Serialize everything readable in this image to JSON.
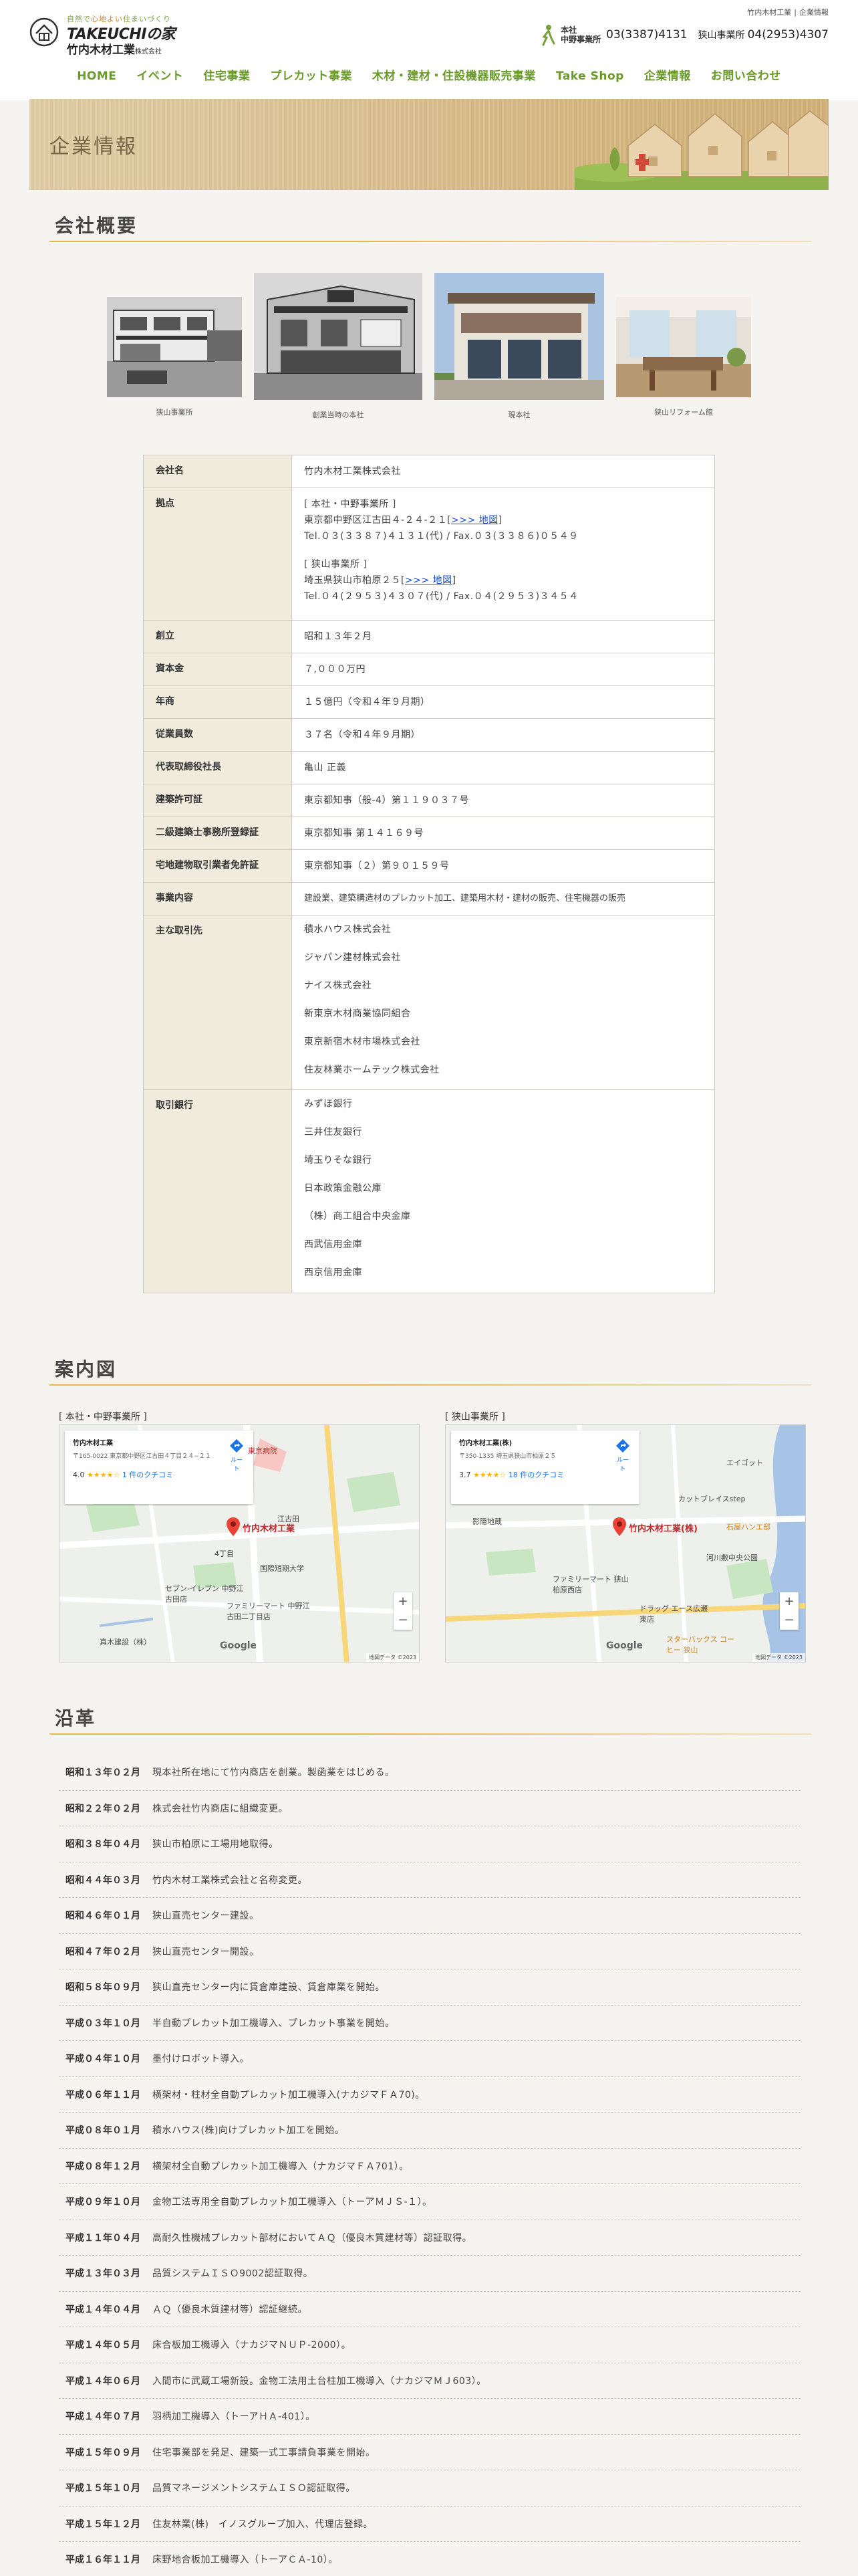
{
  "header": {
    "tagline_pre": "自然で",
    "tagline_em": "心地よい",
    "tagline_post": "住まいづくり",
    "brand": "TAKEUCHIの家",
    "company": "竹内木材工業",
    "company_suffix": "株式会社",
    "util_links": [
      "竹内木材工業",
      "企業情報"
    ],
    "contact": {
      "label_line1": "本社",
      "label_line2": "中野事業所",
      "tel_main": "03(3387)4131",
      "sub_label": "狭山事業所",
      "tel_sub": "04(2953)4307"
    },
    "nav": [
      "HOME",
      "イベント",
      "住宅事業",
      "プレカット事業",
      "木材・建材・住設機器販売事業",
      "Take Shop",
      "企業情報",
      "お問い合わせ"
    ]
  },
  "hero": {
    "title": "企業情報"
  },
  "sections": {
    "overview": "会社概要",
    "map": "案内図",
    "history": "沿革"
  },
  "photos": [
    {
      "caption": "狭山事業所"
    },
    {
      "caption": "創業当時の本社"
    },
    {
      "caption": "現本社"
    },
    {
      "caption": "狭山リフォーム館"
    }
  ],
  "overview": {
    "name": {
      "label": "会社名",
      "value": "竹内木材工業株式会社"
    },
    "bases": {
      "label": "拠点",
      "main_title": "[ 本社・中野事業所 ]",
      "main_addr": "東京都中野区江古田４-２４-２１",
      "main_tel": "Tel.０３(３３８７)４１３１(代) / Fax.０３(３３８６)０５４９",
      "sub_title": "[ 狭山事業所 ]",
      "sub_addr": "埼玉県狭山市柏原２５",
      "sub_tel": "Tel.０４(２９５３)４３０７(代) / Fax.０４(２９５３)３４５４",
      "map_link": ">>> 地図"
    },
    "founded": {
      "label": "創立",
      "value": "昭和１３年２月"
    },
    "capital": {
      "label": "資本金",
      "value": "７,０００万円"
    },
    "sales": {
      "label": "年商",
      "value": "１５億円（令和４年９月期）"
    },
    "employees": {
      "label": "従業員数",
      "value": "３７名（令和４年９月期）"
    },
    "president": {
      "label": "代表取締役社長",
      "value": "亀山 正義"
    },
    "construction_license": {
      "label": "建築許可証",
      "value": "東京都知事（般-4）第１１９０３７号"
    },
    "architect_office": {
      "label": "二級建築士事務所登録証",
      "value": "東京都知事 第１４１６９号"
    },
    "realestate_license": {
      "label": "宅地建物取引業者免許証",
      "value": "東京都知事（２）第９０１５９号"
    },
    "business": {
      "label": "事業内容",
      "value": "建設業、建築構造材のプレカット加工、建築用木材・建材の販売、住宅機器の販売"
    },
    "clients": {
      "label": "主な取引先",
      "items": [
        "積水ハウス株式会社",
        "ジャパン建材株式会社",
        "ナイス株式会社",
        "新東京木材商業協同組合",
        "東京新宿木材市場株式会社",
        "住友林業ホームテック株式会社"
      ]
    },
    "banks": {
      "label": "取引銀行",
      "items": [
        "みずほ銀行",
        "三井住友銀行",
        "埼玉りそな銀行",
        "日本政策金融公庫",
        "（株）商工組合中央金庫",
        "西武信用金庫",
        "西京信用金庫"
      ]
    }
  },
  "maps": [
    {
      "label": "[ 本社・中野事業所 ]",
      "card_name": "竹内木材工業",
      "card_addr": "〒165-0022 東京都中野区江古田４丁目２４−２１",
      "rating": "4.0",
      "stars": "★★★★☆",
      "reviews": "1 件のクチコミ",
      "directions": "ルート",
      "pin_label": "竹内木材工業",
      "places": [
        "東京病院",
        "江古田",
        "4丁目",
        "国際短期大学",
        "セブン-イレブン 中野江古田店",
        "ファミリーマート 中野江古田二丁目店",
        "真木建設（株）"
      ],
      "footer": "地図データ ©2023"
    },
    {
      "label": "[ 狭山事業所 ]",
      "card_name": "竹内木材工業(株)",
      "card_addr": "〒350-1335 埼玉県狭山市柏原２５",
      "rating": "3.7",
      "stars": "★★★★☆",
      "reviews": "18 件のクチコミ",
      "directions": "ルート",
      "pin_label": "竹内木材工業(株)",
      "places": [
        "エイゴット",
        "カットブレイスstep",
        "影隠地蔵",
        "石屋ハンエ邸",
        "河川敷中央公園",
        "ファミリーマート 狭山柏原西店",
        "ドラッグ エース広瀬東店",
        "スターバックス コーヒー 狭山"
      ],
      "footer": "地図データ ©2023"
    }
  ],
  "history": [
    {
      "date": "昭和１３年０２月",
      "text": "現本社所在地にて竹内商店を創業。製函業をはじめる。"
    },
    {
      "date": "昭和２２年０２月",
      "text": "株式会社竹内商店に組織変更。"
    },
    {
      "date": "昭和３８年０４月",
      "text": "狭山市柏原に工場用地取得。"
    },
    {
      "date": "昭和４４年０３月",
      "text": "竹内木材工業株式会社と名称変更。"
    },
    {
      "date": "昭和４６年０１月",
      "text": "狭山直売センター建設。"
    },
    {
      "date": "昭和４７年０２月",
      "text": "狭山直売センター開設。"
    },
    {
      "date": "昭和５８年０９月",
      "text": "狭山直売センター内に賃倉庫建設、賃倉庫業を開始。"
    },
    {
      "date": "平成０３年１０月",
      "text": "半自動プレカット加工機導入、プレカット事業を開始。"
    },
    {
      "date": "平成０４年１０月",
      "text": "墨付けロボット導入。"
    },
    {
      "date": "平成０６年１１月",
      "text": "横架材・柱材全自動プレカット加工機導入(ナカジマＦＡ70)。"
    },
    {
      "date": "平成０８年０１月",
      "text": "積水ハウス(株)向けプレカット加工を開始。"
    },
    {
      "date": "平成０８年１２月",
      "text": "横架材全自動プレカット加工機導入（ナカジマＦＡ701）。"
    },
    {
      "date": "平成０９年１０月",
      "text": "金物工法専用全自動プレカット加工機導入（トーアＭＪＳ-１）。"
    },
    {
      "date": "平成１１年０４月",
      "text": "高耐久性機械プレカット部材においてＡＱ（優良木質建材等）認証取得。"
    },
    {
      "date": "平成１３年０３月",
      "text": "品質システムＩＳＯ9002認証取得。"
    },
    {
      "date": "平成１４年０４月",
      "text": "ＡＱ（優良木質建材等）認証継続。"
    },
    {
      "date": "平成１４年０５月",
      "text": "床合板加工機導入（ナカジマＮＵＰ-2000）。"
    },
    {
      "date": "平成１４年０６月",
      "text": "入間市に武蔵工場新設。金物工法用土台柱加工機導入（ナカジマＭＪ603）。"
    },
    {
      "date": "平成１４年０７月",
      "text": "羽柄加工機導入（トーアＨＡ-401）。"
    },
    {
      "date": "平成１５年０９月",
      "text": "住宅事業部を発足、建築一式工事請負事業を開始。"
    },
    {
      "date": "平成１５年１０月",
      "text": "品質マネージメントシステムＩＳＯ認証取得。"
    },
    {
      "date": "平成１５年１２月",
      "text": "住友林業(株)　イノスグループ加入、代理店登録。"
    },
    {
      "date": "平成１６年１１月",
      "text": "床野地合板加工機導入（トーアＣＡ-10）。"
    }
  ],
  "colors": {
    "nav_green": "#6a9a2a",
    "accent_gold": "#e8b74a",
    "table_head": "#f0ebdc",
    "pin_red": "#c4282c"
  }
}
